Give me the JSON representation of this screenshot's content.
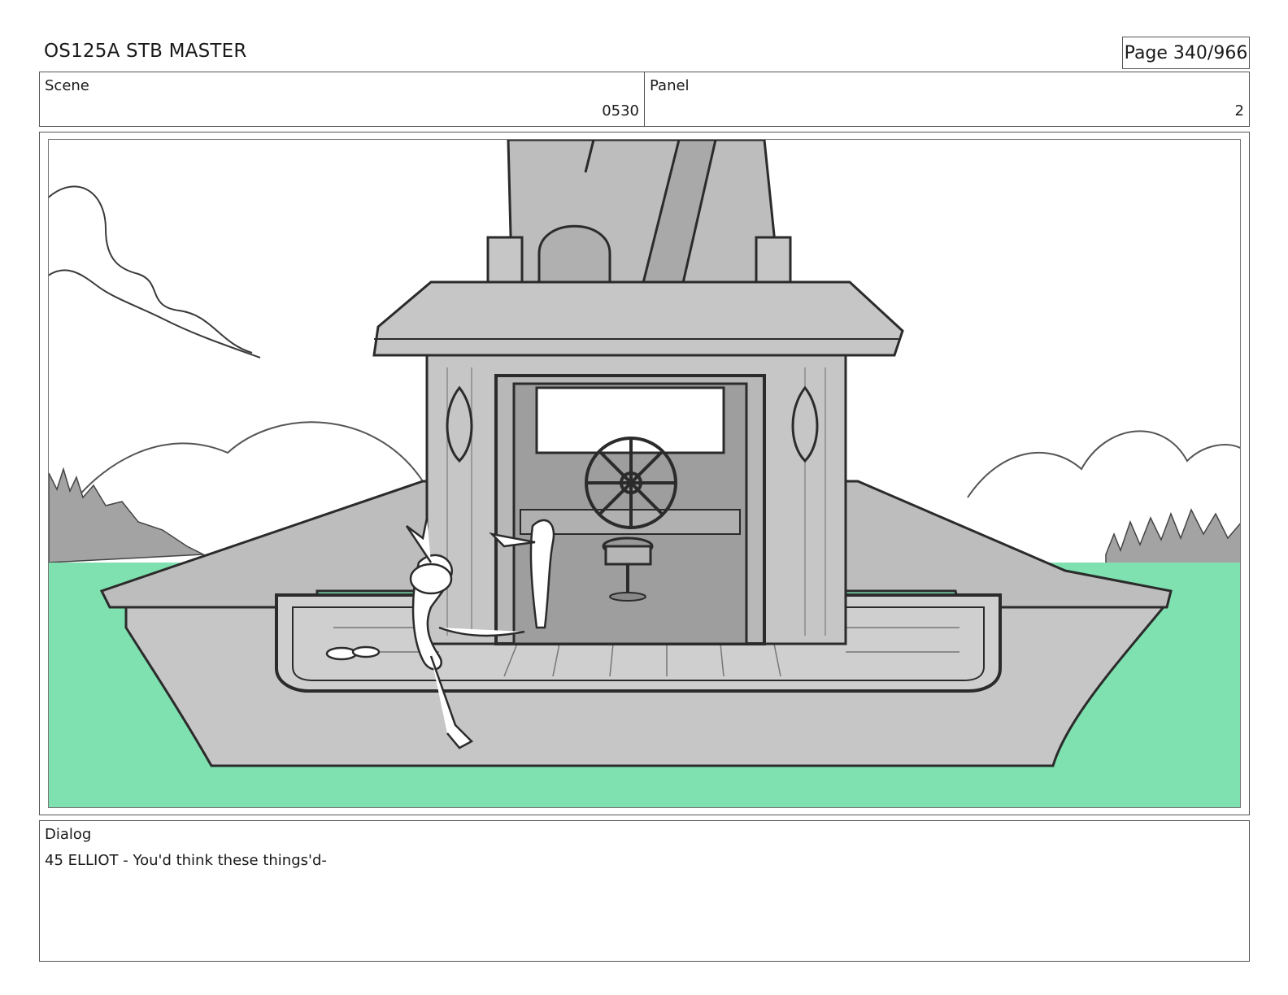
{
  "header": {
    "title": "OS125A STB MASTER",
    "page": "Page 340/966"
  },
  "meta": {
    "scene_label": "Scene",
    "scene_value": "0530",
    "panel_label": "Panel",
    "panel_value": "2"
  },
  "dialog": {
    "label": "Dialog",
    "text": "45 ELLIOT - You'd think these things'd-"
  },
  "colors": {
    "water": "#7fe0b0",
    "boat": "#c6c6c6",
    "boat_dark": "#a9a9a9",
    "line": "#2b2b2b",
    "trees": "#a0a0a0"
  }
}
